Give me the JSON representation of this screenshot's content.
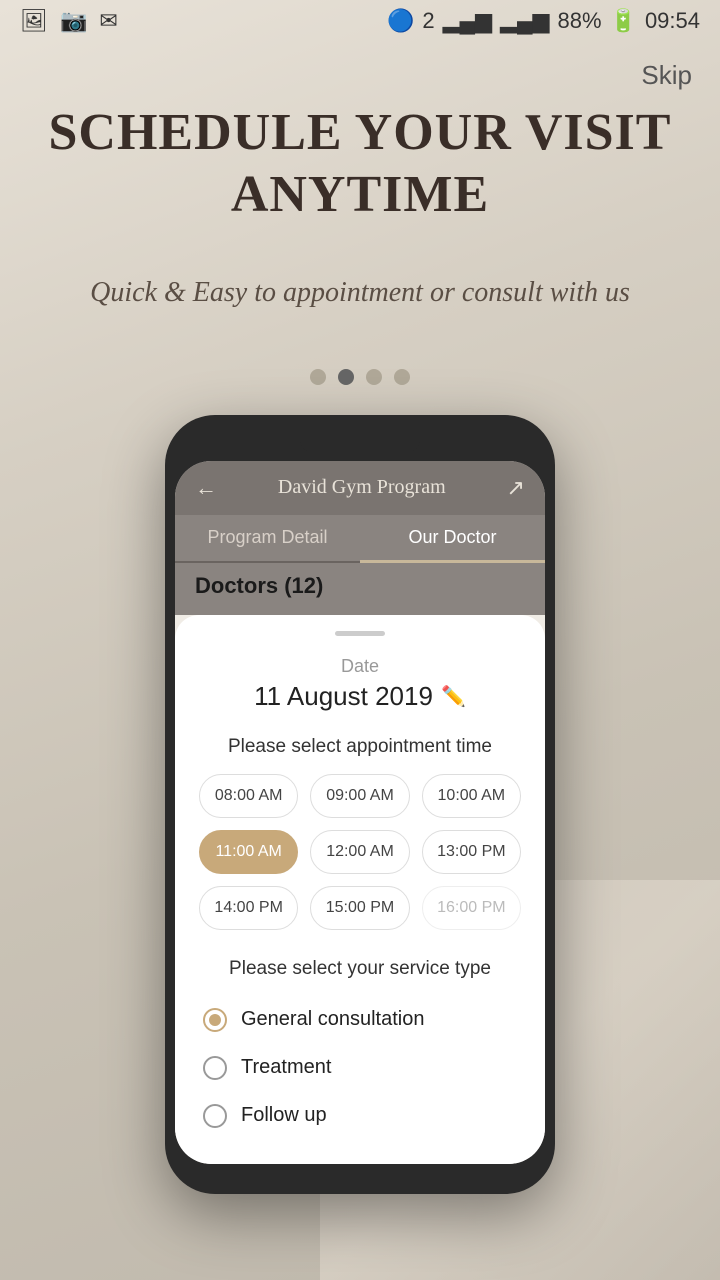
{
  "statusBar": {
    "battery": "88%",
    "time": "09:54",
    "signal": "📶",
    "bluetooth": "🔵"
  },
  "skip": "Skip",
  "hero": {
    "title": "SCHEDULE YOUR VISIT ANYTIME",
    "subtitle": "Quick & Easy to appointment or consult with us"
  },
  "dots": [
    {
      "active": false
    },
    {
      "active": true
    },
    {
      "active": false
    },
    {
      "active": false
    }
  ],
  "phone": {
    "nav": {
      "back_icon": "←",
      "title": "David Gym Program",
      "share_icon": "↗"
    },
    "tabs": [
      {
        "label": "Program Detail",
        "active": false
      },
      {
        "label": "Our Doctor",
        "active": true
      }
    ],
    "doctors_header": "Doctors (12)",
    "modal": {
      "handle": true,
      "date_label": "Date",
      "date_value": "11 August 2019",
      "pencil": "✏️",
      "time_section_title": "Please select appointment time",
      "times": [
        {
          "label": "08:00 AM",
          "selected": false,
          "disabled": false
        },
        {
          "label": "09:00 AM",
          "selected": false,
          "disabled": false
        },
        {
          "label": "10:00 AM",
          "selected": false,
          "disabled": false
        },
        {
          "label": "11:00 AM",
          "selected": true,
          "disabled": false
        },
        {
          "label": "12:00 AM",
          "selected": false,
          "disabled": false
        },
        {
          "label": "13:00 PM",
          "selected": false,
          "disabled": false
        },
        {
          "label": "14:00 PM",
          "selected": false,
          "disabled": false
        },
        {
          "label": "15:00 PM",
          "selected": false,
          "disabled": false
        },
        {
          "label": "16:00 PM",
          "selected": false,
          "disabled": true
        }
      ],
      "service_section_title": "Please select your service type",
      "services": [
        {
          "label": "General consultation",
          "checked": true
        },
        {
          "label": "Treatment",
          "checked": false
        },
        {
          "label": "Follow up",
          "checked": false
        }
      ]
    }
  }
}
